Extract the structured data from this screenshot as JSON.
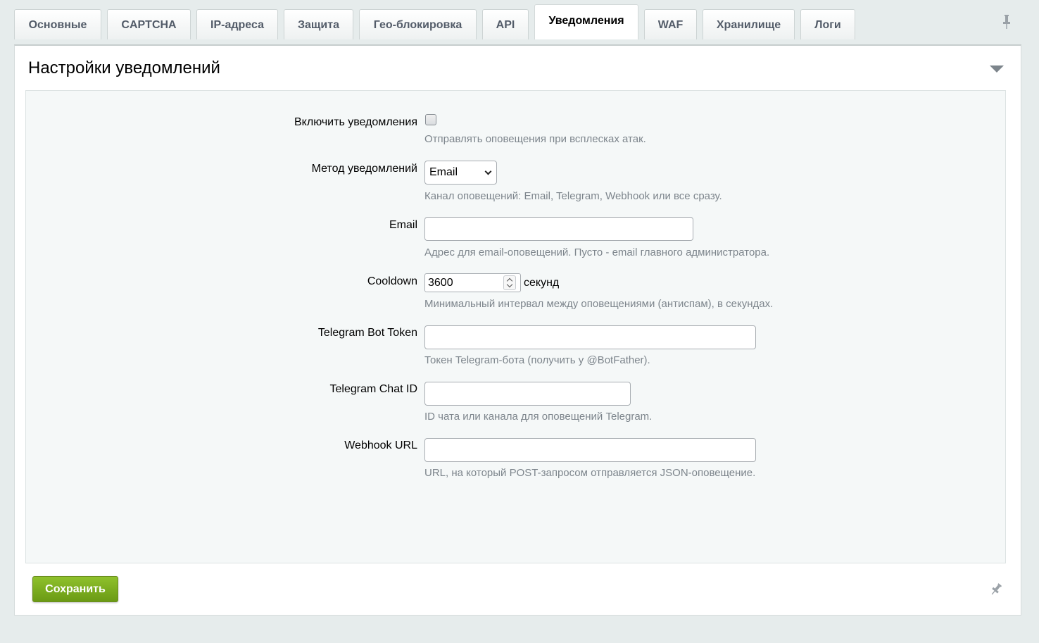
{
  "tabs": [
    {
      "label": "Основные",
      "active": false
    },
    {
      "label": "CAPTCHA",
      "active": false
    },
    {
      "label": "IP-адреса",
      "active": false
    },
    {
      "label": "Защита",
      "active": false
    },
    {
      "label": "Гео-блокировка",
      "active": false
    },
    {
      "label": "API",
      "active": false
    },
    {
      "label": "Уведомления",
      "active": true
    },
    {
      "label": "WAF",
      "active": false
    },
    {
      "label": "Хранилище",
      "active": false
    },
    {
      "label": "Логи",
      "active": false
    }
  ],
  "panel": {
    "title": "Настройки уведомлений"
  },
  "fields": {
    "enable": {
      "label": "Включить уведомления",
      "checked": false,
      "hint": "Отправлять оповещения при всплесках атак."
    },
    "method": {
      "label": "Метод уведомлений",
      "value": "Email",
      "hint": "Канал оповещений: Email, Telegram, Webhook или все сразу."
    },
    "email": {
      "label": "Email",
      "value": "",
      "hint": "Адрес для email-оповещений. Пусто - email главного администратора."
    },
    "cooldown": {
      "label": "Cooldown",
      "value": "3600",
      "unit": "секунд",
      "hint": "Минимальный интервал между оповещениями (антиспам), в секундах."
    },
    "telegram_token": {
      "label": "Telegram Bot Token",
      "value": "",
      "hint": "Токен Telegram-бота (получить у @BotFather)."
    },
    "telegram_chat": {
      "label": "Telegram Chat ID",
      "value": "",
      "hint": "ID чата или канала для оповещений Telegram."
    },
    "webhook": {
      "label": "Webhook URL",
      "value": "",
      "hint": "URL, на который POST-запросом отправляется JSON-оповещение."
    }
  },
  "actions": {
    "save_label": "Сохранить"
  },
  "colors": {
    "accent_green": "#7aad1f",
    "hint_gray": "#7d858c",
    "background": "#e6ecec"
  }
}
